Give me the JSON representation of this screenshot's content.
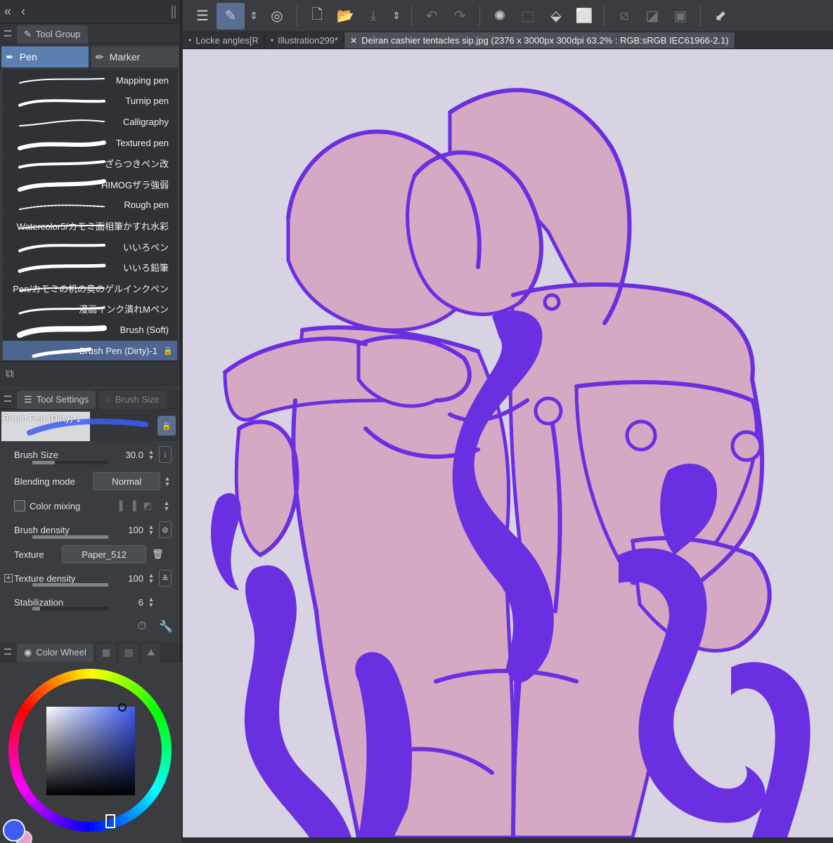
{
  "left_panel": {
    "tool_group_tab": "Tool Group",
    "subtabs": {
      "pen": "Pen",
      "marker": "Marker"
    },
    "brushes": [
      {
        "name": "Mapping pen"
      },
      {
        "name": "Turnip pen"
      },
      {
        "name": "Calligraphy"
      },
      {
        "name": "Textured pen"
      },
      {
        "name": "ざらつきペン改"
      },
      {
        "name": "HIMOGザラ強弱"
      },
      {
        "name": "Rough pen"
      },
      {
        "name": "Watercolor5/カモミ面相筆かすれ水彩"
      },
      {
        "name": "いいろペン"
      },
      {
        "name": "いいろ鉛筆"
      },
      {
        "name": "Pen/カモミの机の奥のゲルインクペン"
      },
      {
        "name": "漫画インク潰れMペン"
      },
      {
        "name": "Brush (Soft)"
      },
      {
        "name": "Brush Pen (Dirty)-1"
      }
    ],
    "tool_settings": {
      "tab": "Tool Settings",
      "tab_dim": "Brush Size",
      "preview_name": "Brush Pen (Dirty)-1",
      "brush_size_label": "Brush Size",
      "brush_size_value": "30.0",
      "brush_size_fraction": 0.3,
      "blending_label": "Blending mode",
      "blending_value": "Normal",
      "color_mixing_label": "Color mixing",
      "brush_density_label": "Brush density",
      "brush_density_value": "100",
      "texture_label": "Texture",
      "texture_value": "Paper_512",
      "texture_density_label": "Texture density",
      "texture_density_value": "100",
      "stabilization_label": "Stabilization",
      "stabilization_value": "6"
    },
    "color_panel": {
      "tab": "Color Wheel",
      "h": "224",
      "s": "86",
      "v": "100",
      "main_color": "#3d5cf5",
      "sub_color": "#e8a0c8"
    }
  },
  "document_tabs": [
    {
      "label": "Locke angles[R",
      "active": false
    },
    {
      "label": "Illustration299*",
      "active": false
    },
    {
      "label": "Deiran cashier tentacles sip.jpg (2376 x 3000px 300dpi 63.2% : RGB:sRGB IEC61966-2.1)",
      "active": true
    }
  ],
  "colors": {
    "canvas_bg": "#d7d3e2",
    "line": "#6a2fe0",
    "fill": "#d5a8c4",
    "accent": "#5c7fb1"
  }
}
